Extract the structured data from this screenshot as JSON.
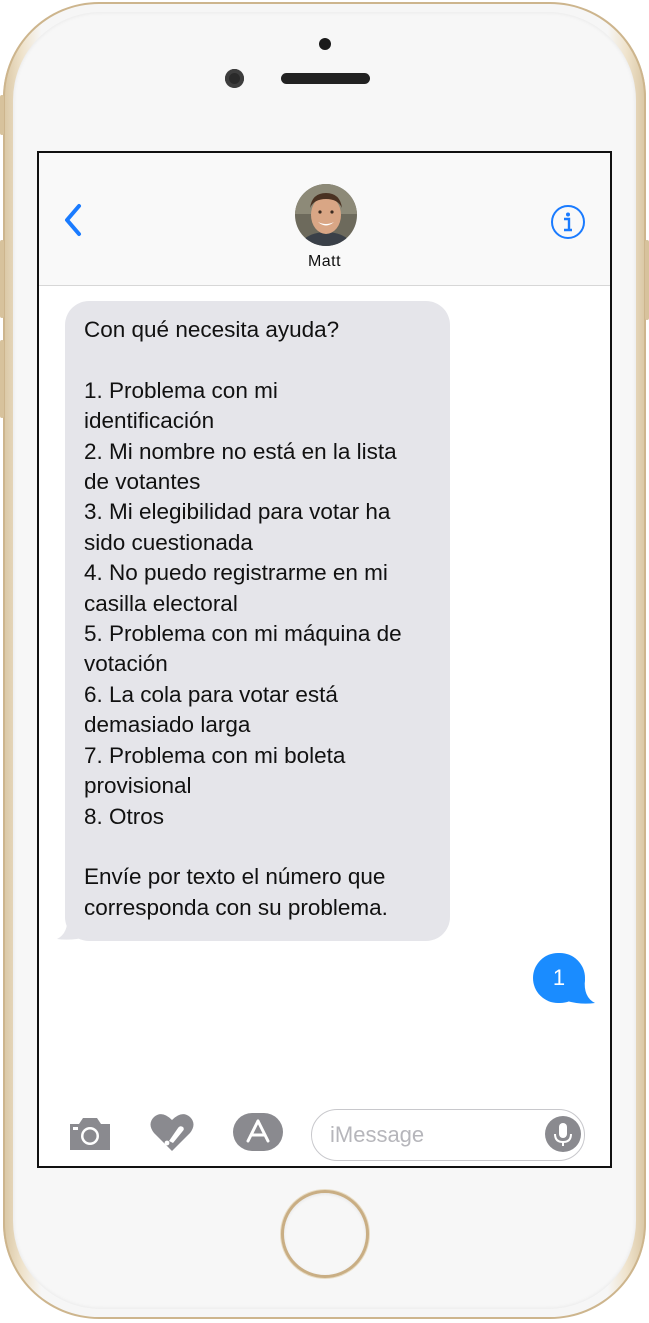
{
  "device": {
    "frame_color": "#e9dcc2"
  },
  "header": {
    "back_icon": "chevron-left-icon",
    "contact_name": "Matt",
    "info_icon": "info-circle-icon",
    "accent_color": "#1a7bff"
  },
  "conversation": {
    "incoming_message": "Con qué necesita ayuda?\n\n1. Problema con mi\nidentificación\n2. Mi nombre no está en la lista\nde votantes\n3. Mi elegibilidad para votar ha\nsido cuestionada\n4. No puedo registrarme en mi\ncasilla electoral\n5. Problema con mi máquina de\nvotación\n6. La cola para votar está\ndemasiado larga\n7. Problema con mi boleta\nprovisional\n8. Otros\n\nEnvíe por texto el número que\ncorresponda con su problema.",
    "outgoing_message": "1",
    "incoming_color": "#e5e5ea",
    "outgoing_color": "#1a8cff"
  },
  "input_bar": {
    "camera_icon": "camera-icon",
    "digital_touch_icon": "heart-touch-icon",
    "app_store_icon": "app-store-icon",
    "placeholder": "iMessage",
    "mic_icon": "microphone-icon"
  }
}
